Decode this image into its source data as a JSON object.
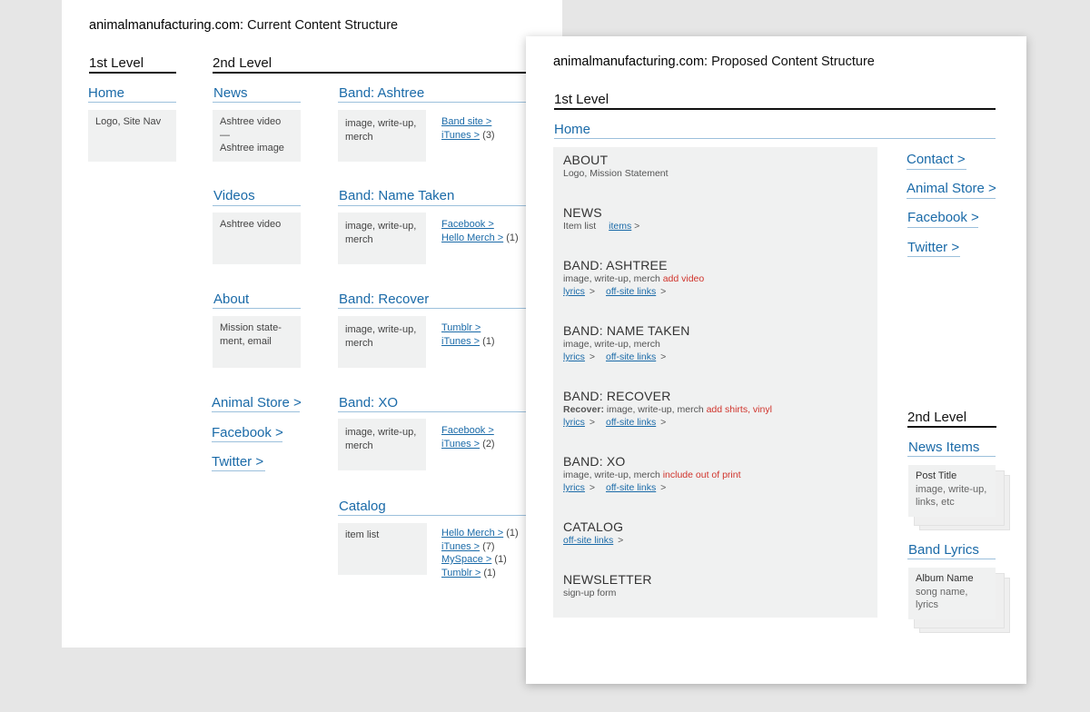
{
  "current": {
    "title_site": "animalmanufacturing.com:",
    "title_rest": " Current Content Structure",
    "level1": "1st Level",
    "level2": "2nd Level",
    "home": {
      "head": "Home",
      "box": "Logo, Site Nav"
    },
    "news": {
      "head": "News",
      "line1": "Ashtree video",
      "line2": "—",
      "line3": "Ashtree image"
    },
    "videos": {
      "head": "Videos",
      "box": "Ashtree video"
    },
    "about": {
      "head": "About",
      "line1": "Mission state-",
      "line2": "ment, email"
    },
    "nav_links": [
      "Animal Store >",
      "Facebook >",
      "Twitter >"
    ],
    "bands": [
      {
        "head": "Band: Ashtree",
        "line1": "image, write-up,",
        "line2": "merch",
        "links": [
          {
            "text": "Band site >",
            "count": ""
          },
          {
            "text": "iTunes >",
            "count": " (3)"
          }
        ]
      },
      {
        "head": "Band: Name Taken",
        "line1": "image, write-up,",
        "line2": "merch",
        "links": [
          {
            "text": "Facebook >",
            "count": ""
          },
          {
            "text": "Hello Merch >",
            "count": " (1)"
          }
        ]
      },
      {
        "head": "Band: Recover",
        "line1": "image, write-up,",
        "line2": "merch",
        "links": [
          {
            "text": "Tumblr >",
            "count": ""
          },
          {
            "text": "iTunes >",
            "count": " (1)"
          }
        ]
      },
      {
        "head": "Band: XO",
        "line1": "image, write-up,",
        "line2": "merch",
        "links": [
          {
            "text": "Facebook >",
            "count": ""
          },
          {
            "text": "iTunes >",
            "count": " (2)"
          }
        ]
      }
    ],
    "catalog": {
      "head": "Catalog",
      "box": "item list",
      "links": [
        {
          "text": "Hello Merch >",
          "count": " (1)"
        },
        {
          "text": "iTunes >",
          "count": " (7)"
        },
        {
          "text": "MySpace >",
          "count": " (1)"
        },
        {
          "text": "Tumblr >",
          "count": " (1)"
        }
      ]
    }
  },
  "proposed": {
    "title_site": "animalmanufacturing.com:",
    "title_rest": " Proposed Content Structure",
    "level1": "1st Level",
    "home": "Home",
    "sections": [
      {
        "title": "ABOUT",
        "desc": "Logo, Mission Statement",
        "desc_red": "",
        "links": []
      },
      {
        "title": "NEWS",
        "desc": "Item list",
        "desc_red": "",
        "inline_link": "items",
        "inline_after": " >",
        "links": []
      },
      {
        "title": "BAND: ASHTREE",
        "desc": "image, write-up, merch ",
        "desc_red": "add video",
        "links": [
          "lyrics",
          "off-site links"
        ]
      },
      {
        "title": "BAND: NAME TAKEN",
        "desc": "image, write-up, merch",
        "desc_red": "",
        "links": [
          "lyrics",
          "off-site links"
        ]
      },
      {
        "title": "BAND: RECOVER",
        "desc_bold": "Recover:",
        "desc": " image, write-up, merch ",
        "desc_red": "add shirts, vinyl",
        "links": [
          "lyrics",
          "off-site links"
        ]
      },
      {
        "title": "BAND: XO",
        "desc": "image, write-up, merch ",
        "desc_red": "include out of print",
        "links": [
          "lyrics",
          "off-site links"
        ]
      },
      {
        "title": "CATALOG",
        "desc": "",
        "desc_red": "",
        "links": [
          "off-site links"
        ]
      },
      {
        "title": "NEWSLETTER",
        "desc": "sign-up form",
        "desc_red": "",
        "links": []
      }
    ],
    "link_suffix": " >",
    "side_links": [
      "Contact >",
      "Animal Store >",
      "Facebook >",
      "Twitter >"
    ],
    "level2": "2nd Level",
    "news_items": {
      "head": "News Items",
      "line1": "Post Title",
      "line2": "image, write-up,",
      "line3": "links, etc"
    },
    "band_lyrics": {
      "head": "Band Lyrics",
      "line1": "Album Name",
      "line2": "song name,",
      "line3": "lyrics"
    }
  }
}
